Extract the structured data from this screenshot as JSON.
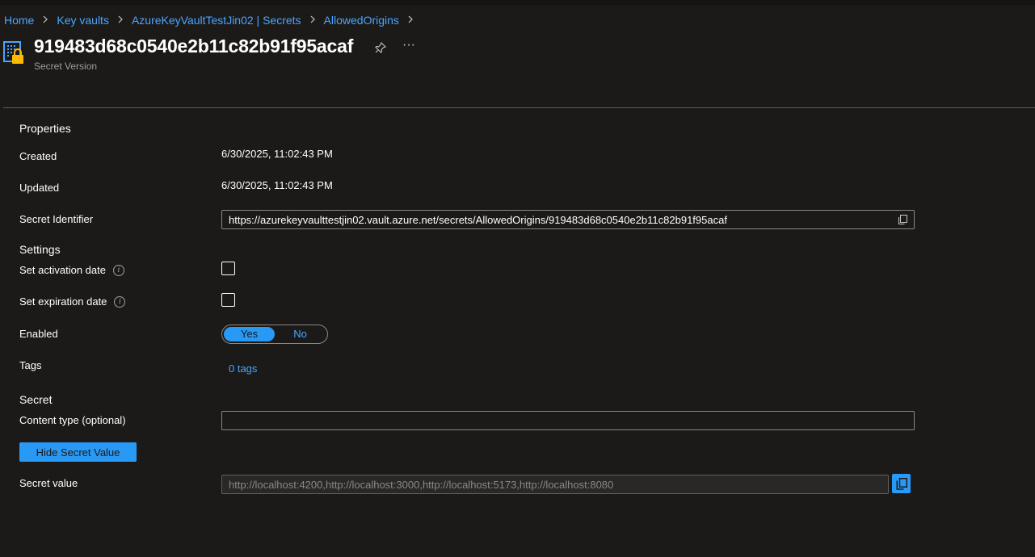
{
  "breadcrumb": [
    {
      "label": "Home"
    },
    {
      "label": "Key vaults"
    },
    {
      "label": "AzureKeyVaultTestJin02 | Secrets"
    },
    {
      "label": "AllowedOrigins"
    }
  ],
  "header": {
    "title": "919483d68c0540e2b11c82b91f95acaf",
    "subtitle": "Secret Version",
    "icon": "key-vault-secret-icon",
    "pin_icon": "pin-icon",
    "more_label": "···"
  },
  "properties": {
    "section_label": "Properties",
    "created_label": "Created",
    "created_value": "6/30/2025, 11:02:43 PM",
    "updated_label": "Updated",
    "updated_value": "6/30/2025, 11:02:43 PM",
    "identifier_label": "Secret Identifier",
    "identifier_value": "https://azurekeyvaulttestjin02.vault.azure.net/secrets/AllowedOrigins/919483d68c0540e2b11c82b91f95acaf"
  },
  "settings": {
    "section_label": "Settings",
    "activation_label": "Set activation date",
    "expiration_label": "Set expiration date",
    "enabled_label": "Enabled",
    "enabled_yes": "Yes",
    "enabled_no": "No",
    "tags_label": "Tags",
    "tags_value": "0 tags"
  },
  "secret": {
    "section_label": "Secret",
    "content_type_label": "Content type (optional)",
    "content_type_value": "",
    "hide_button": "Hide Secret Value",
    "value_label": "Secret value",
    "value": "http://localhost:4200,http://localhost:3000,http://localhost:5173,http://localhost:8080"
  },
  "colors": {
    "background": "#1b1a19",
    "accent": "#2899f5",
    "link": "#4aa5ff"
  }
}
